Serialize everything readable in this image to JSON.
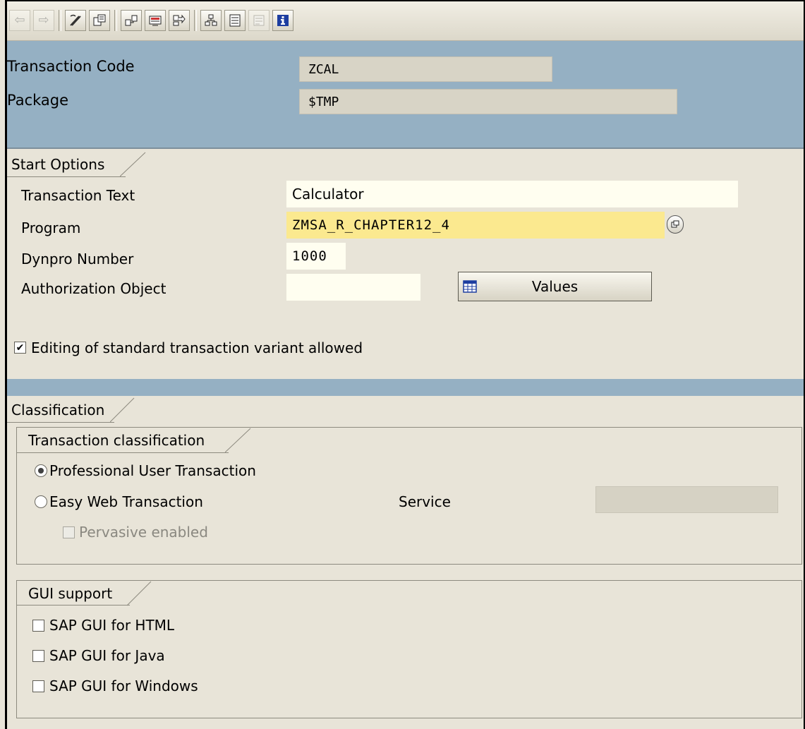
{
  "toolbar": {
    "buttons": [
      {
        "icon": "back-arrow-icon",
        "enabled": false
      },
      {
        "icon": "forward-arrow-icon",
        "enabled": false
      },
      {
        "icon": "display-change-icon",
        "enabled": true
      },
      {
        "icon": "other-object-icon",
        "enabled": true
      },
      {
        "icon": "where-used-icon",
        "enabled": true
      },
      {
        "icon": "display-object-list-icon",
        "enabled": true
      },
      {
        "icon": "navigate-icon",
        "enabled": true
      },
      {
        "icon": "hierarchy-icon",
        "enabled": true
      },
      {
        "icon": "object-list-icon",
        "enabled": true
      },
      {
        "icon": "layout-icon",
        "enabled": false
      },
      {
        "icon": "info-icon",
        "enabled": true
      }
    ]
  },
  "header": {
    "transaction_code_label": "Transaction Code",
    "transaction_code_value": "ZCAL",
    "package_label": "Package",
    "package_value": "$TMP"
  },
  "start_options": {
    "title": "Start Options",
    "transaction_text_label": "Transaction Text",
    "transaction_text_value": "Calculator",
    "program_label": "Program",
    "program_value": "ZMSA_R_CHAPTER12_4",
    "dynpro_label": "Dynpro Number",
    "dynpro_value": "1000",
    "auth_object_label": "Authorization Object",
    "auth_object_value": "",
    "values_button_label": "Values",
    "editing_variant_label": "Editing of standard transaction variant allowed",
    "editing_variant_checked": true
  },
  "classification": {
    "title": "Classification",
    "transaction_classification": {
      "title": "Transaction classification",
      "professional_label": "Professional User Transaction",
      "easy_web_label": "Easy Web Transaction",
      "service_label": "Service",
      "service_value": "",
      "pervasive_label": "Pervasive enabled",
      "selected": "professional"
    },
    "gui_support": {
      "title": "GUI support",
      "html_label": "SAP GUI for HTML",
      "java_label": "SAP GUI for Java",
      "windows_label": "SAP GUI for Windows"
    }
  },
  "colors": {
    "header_band": "#95b0c3",
    "background": "#e8e4d8",
    "required_field": "#fbe98f",
    "input_field": "#fffef0"
  }
}
